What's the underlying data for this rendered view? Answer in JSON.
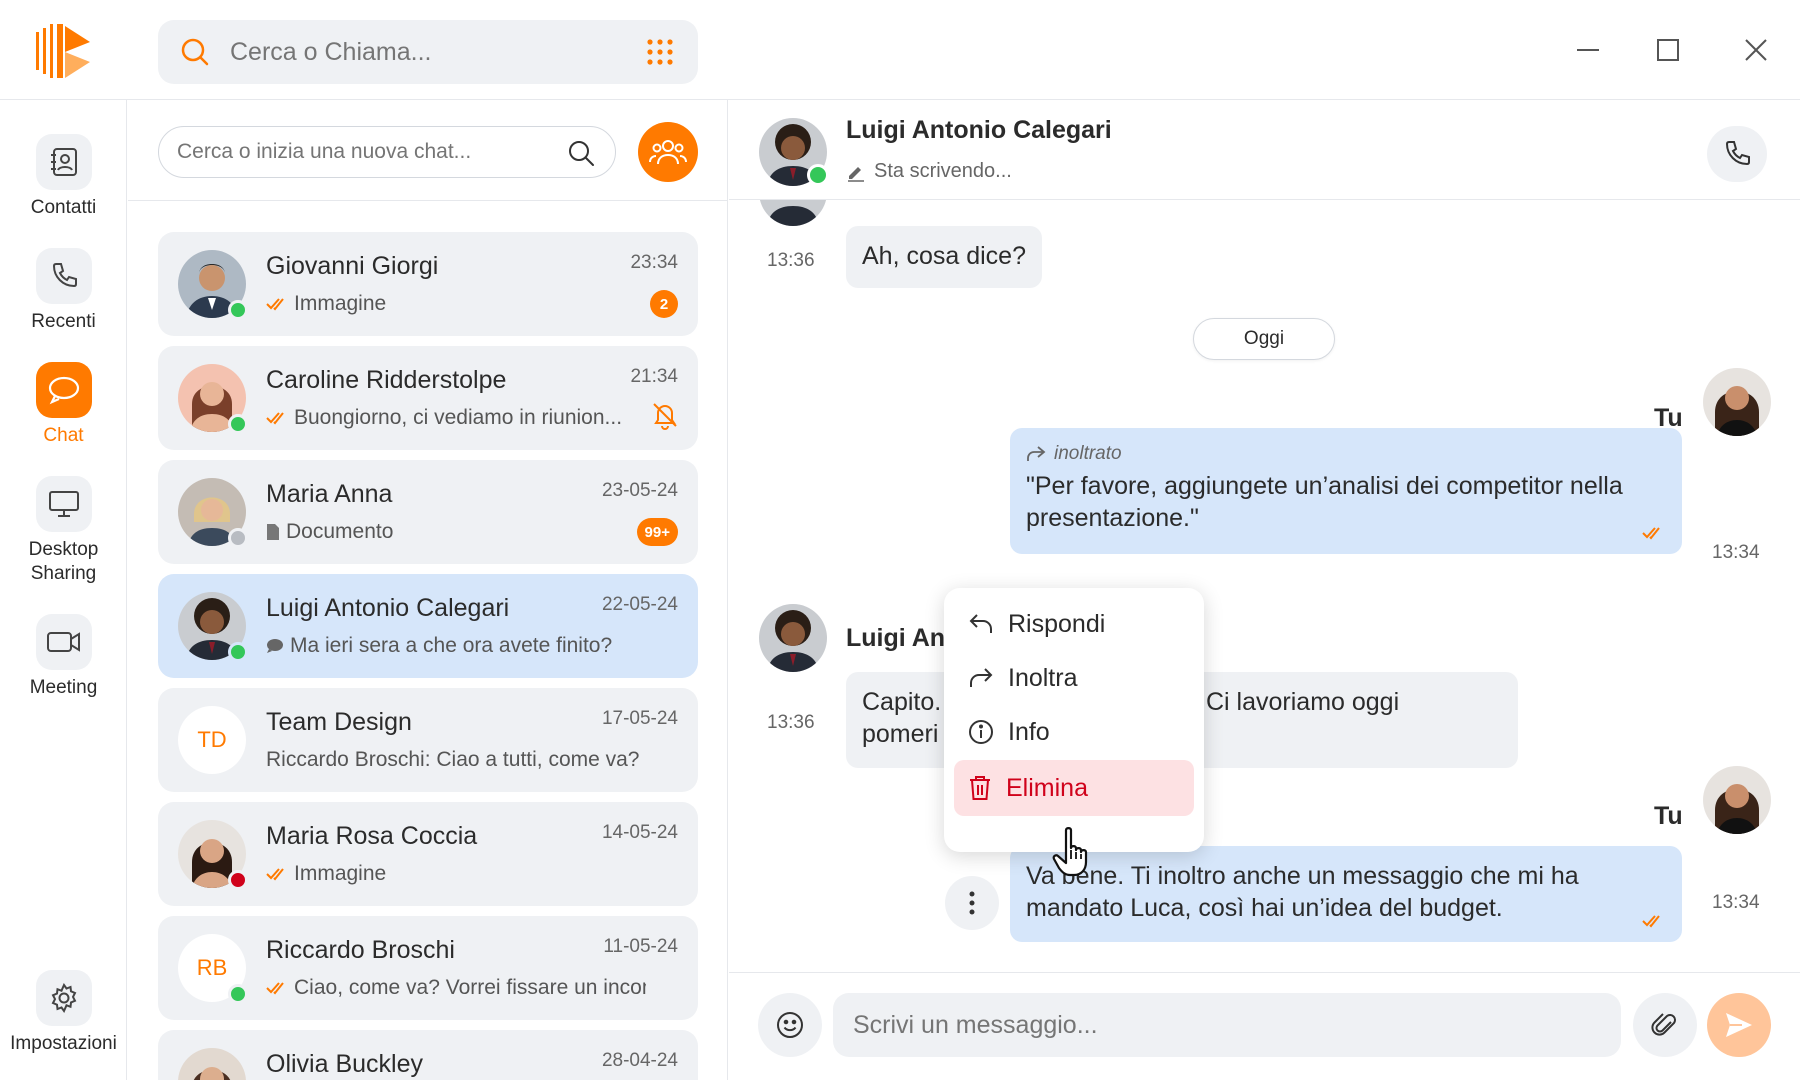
{
  "app": {
    "global_search_placeholder": "Cerca o Chiama...",
    "accent": "#ff7a00",
    "online": "#34c759",
    "busy": "#d0021b",
    "away": "#b8bcc2"
  },
  "window_controls": [
    "minimize-icon",
    "maximize-icon",
    "close-icon"
  ],
  "rail": {
    "items": [
      {
        "label": "Contatti",
        "icon": "contacts-icon"
      },
      {
        "label": "Recenti",
        "icon": "phone-icon"
      },
      {
        "label": "Chat",
        "icon": "chat-icon",
        "active": true
      },
      {
        "label": "Desktop Sharing",
        "icon": "monitor-icon"
      },
      {
        "label": "Meeting",
        "icon": "video-icon"
      }
    ],
    "settings": {
      "label": "Impostazioni",
      "icon": "gear-icon"
    }
  },
  "chatlist": {
    "search_placeholder": "Cerca o inizia una nuova chat...",
    "items": [
      {
        "name": "Giovanni Giorgi",
        "preview": "Immagine",
        "time": "23:34",
        "badge": "2",
        "status": "online",
        "preview_icon": "double-check-icon"
      },
      {
        "name": "Caroline Ridderstolpe",
        "preview": "Buongiorno, ci vediamo in riunion...",
        "time": "21:34",
        "muted": true,
        "status": "online",
        "preview_icon": "double-check-icon"
      },
      {
        "name": "Maria Anna",
        "preview": "Documento",
        "time": "23-05-24",
        "badge": "99+",
        "status": "away",
        "preview_icon": "document-icon"
      },
      {
        "name": "Luigi Antonio Calegari",
        "preview": "Ma ieri sera a che ora avete finito?",
        "time": "22-05-24",
        "selected": true,
        "status": "online",
        "preview_icon": "message-icon"
      },
      {
        "name": "Team Design",
        "preview": "Riccardo Broschi: Ciao a tutti, come va?",
        "time": "17-05-24",
        "initials": "TD"
      },
      {
        "name": "Maria Rosa Coccia",
        "preview": "Immagine",
        "time": "14-05-24",
        "status": "busy",
        "preview_icon": "double-check-icon"
      },
      {
        "name": "Riccardo Broschi",
        "preview": "Ciao, come va? Vorrei fissare un incon...",
        "time": "11-05-24",
        "initials": "RB",
        "status": "online",
        "preview_icon": "double-check-icon"
      },
      {
        "name": "Olivia Buckley",
        "preview": "",
        "time": "28-04-24"
      }
    ]
  },
  "conversation": {
    "contact_name": "Luigi Antonio Calegari",
    "status": "Sta scrivendo...",
    "date_separator": "Oggi",
    "messages": [
      {
        "text": "Ah, cosa dice?",
        "time": "13:36",
        "dir": "in"
      },
      {
        "sender": "Tu",
        "forwarded_label": "inoltrato",
        "text": "\"Per favore, aggiungete un’analisi dei competitor nella presentazione.\"",
        "time": "13:34",
        "dir": "out"
      },
      {
        "sender": "Luigi Ant",
        "text_a": "Capito.",
        "text_b": "Ci lavoriamo oggi",
        "text_c": "pomeri",
        "time": "13:36",
        "dir": "in"
      },
      {
        "sender": "Tu",
        "text": "Va bene. Ti inoltro anche un messaggio che mi ha mandato Luca, così hai un’idea del budget.",
        "time": "13:34",
        "dir": "out"
      }
    ],
    "context_menu": [
      "Rispondi",
      "Inoltra",
      "Info",
      "Elimina"
    ],
    "composer_placeholder": "Scrivi un messaggio..."
  }
}
